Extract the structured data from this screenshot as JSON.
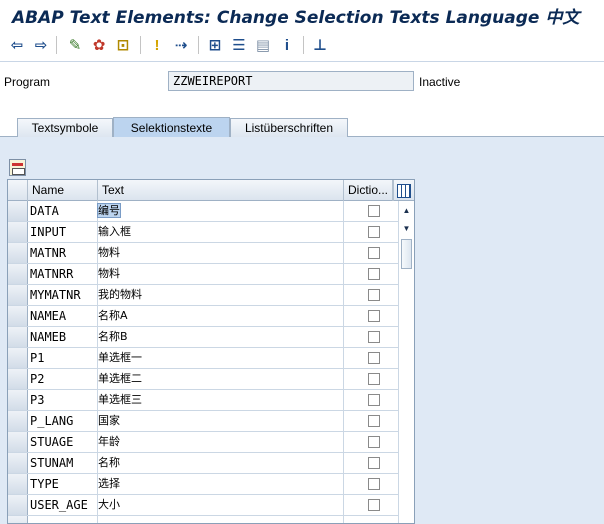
{
  "window": {
    "title": "ABAP Text Elements: Change Selection Texts Language 中文"
  },
  "toolbar": {
    "buttons": [
      {
        "name": "back-icon",
        "glyph": "⇦",
        "color": "#1f4e8c"
      },
      {
        "name": "forward-icon",
        "glyph": "⇨",
        "color": "#1f4e8c"
      },
      {
        "name": "display-change-icon",
        "glyph": "✎",
        "color": "#3a7a2a"
      },
      {
        "name": "activate-icon",
        "glyph": "✿",
        "color": "#c0392b"
      },
      {
        "name": "other-object-icon",
        "glyph": "⊡",
        "color": "#b08a00"
      },
      {
        "name": "info-pin-icon",
        "glyph": "!",
        "color": "#d4a400"
      },
      {
        "name": "navigate-icon",
        "glyph": "⇢",
        "color": "#1f4e8c"
      },
      {
        "name": "hierarchy-icon",
        "glyph": "⊞",
        "color": "#1f4e8c"
      },
      {
        "name": "print-list-icon",
        "glyph": "☰",
        "color": "#1f4e8c"
      },
      {
        "name": "table-view-icon",
        "glyph": "▤",
        "color": "#7d8fa5"
      },
      {
        "name": "information-icon",
        "glyph": "i",
        "color": "#1f4e8c"
      },
      {
        "name": "tree-structure-icon",
        "glyph": "⊥",
        "color": "#1f4e8c"
      }
    ]
  },
  "program": {
    "label": "Program",
    "value": "ZZWEIREPORT",
    "status": "Inactive"
  },
  "tabs": [
    {
      "label": "Textsymbole",
      "active": false
    },
    {
      "label": "Selektionstexte",
      "active": true
    },
    {
      "label": "Listüberschriften",
      "active": false
    }
  ],
  "table": {
    "columns": {
      "name": "Name",
      "text": "Text",
      "dictionary": "Dictio..."
    },
    "rows": [
      {
        "name": "DATA",
        "text": "编号",
        "dict": false
      },
      {
        "name": "INPUT",
        "text": "输入框",
        "dict": false
      },
      {
        "name": "MATNR",
        "text": "物料",
        "dict": false
      },
      {
        "name": "MATNRR",
        "text": "物料",
        "dict": false
      },
      {
        "name": "MYMATNR",
        "text": "我的物料",
        "dict": false
      },
      {
        "name": "NAMEA",
        "text": "名称A",
        "dict": false
      },
      {
        "name": "NAMEB",
        "text": "名称B",
        "dict": false
      },
      {
        "name": "P1",
        "text": "单选框一",
        "dict": false
      },
      {
        "name": "P2",
        "text": "单选框二",
        "dict": false
      },
      {
        "name": "P3",
        "text": "单选框三",
        "dict": false
      },
      {
        "name": "P_LANG",
        "text": "国家",
        "dict": false
      },
      {
        "name": "STUAGE",
        "text": "年龄",
        "dict": false
      },
      {
        "name": "STUNAM",
        "text": "名称",
        "dict": false
      },
      {
        "name": "TYPE",
        "text": "选择",
        "dict": false
      },
      {
        "name": "USER_AGE",
        "text": "大小",
        "dict": false
      },
      {
        "name": "",
        "text": "",
        "dict": null
      }
    ]
  },
  "colors": {
    "title": "#0b2a55",
    "background": "#dfe9f5",
    "active_tab": "#bcd4ef",
    "selection": "#bcd4ef"
  }
}
